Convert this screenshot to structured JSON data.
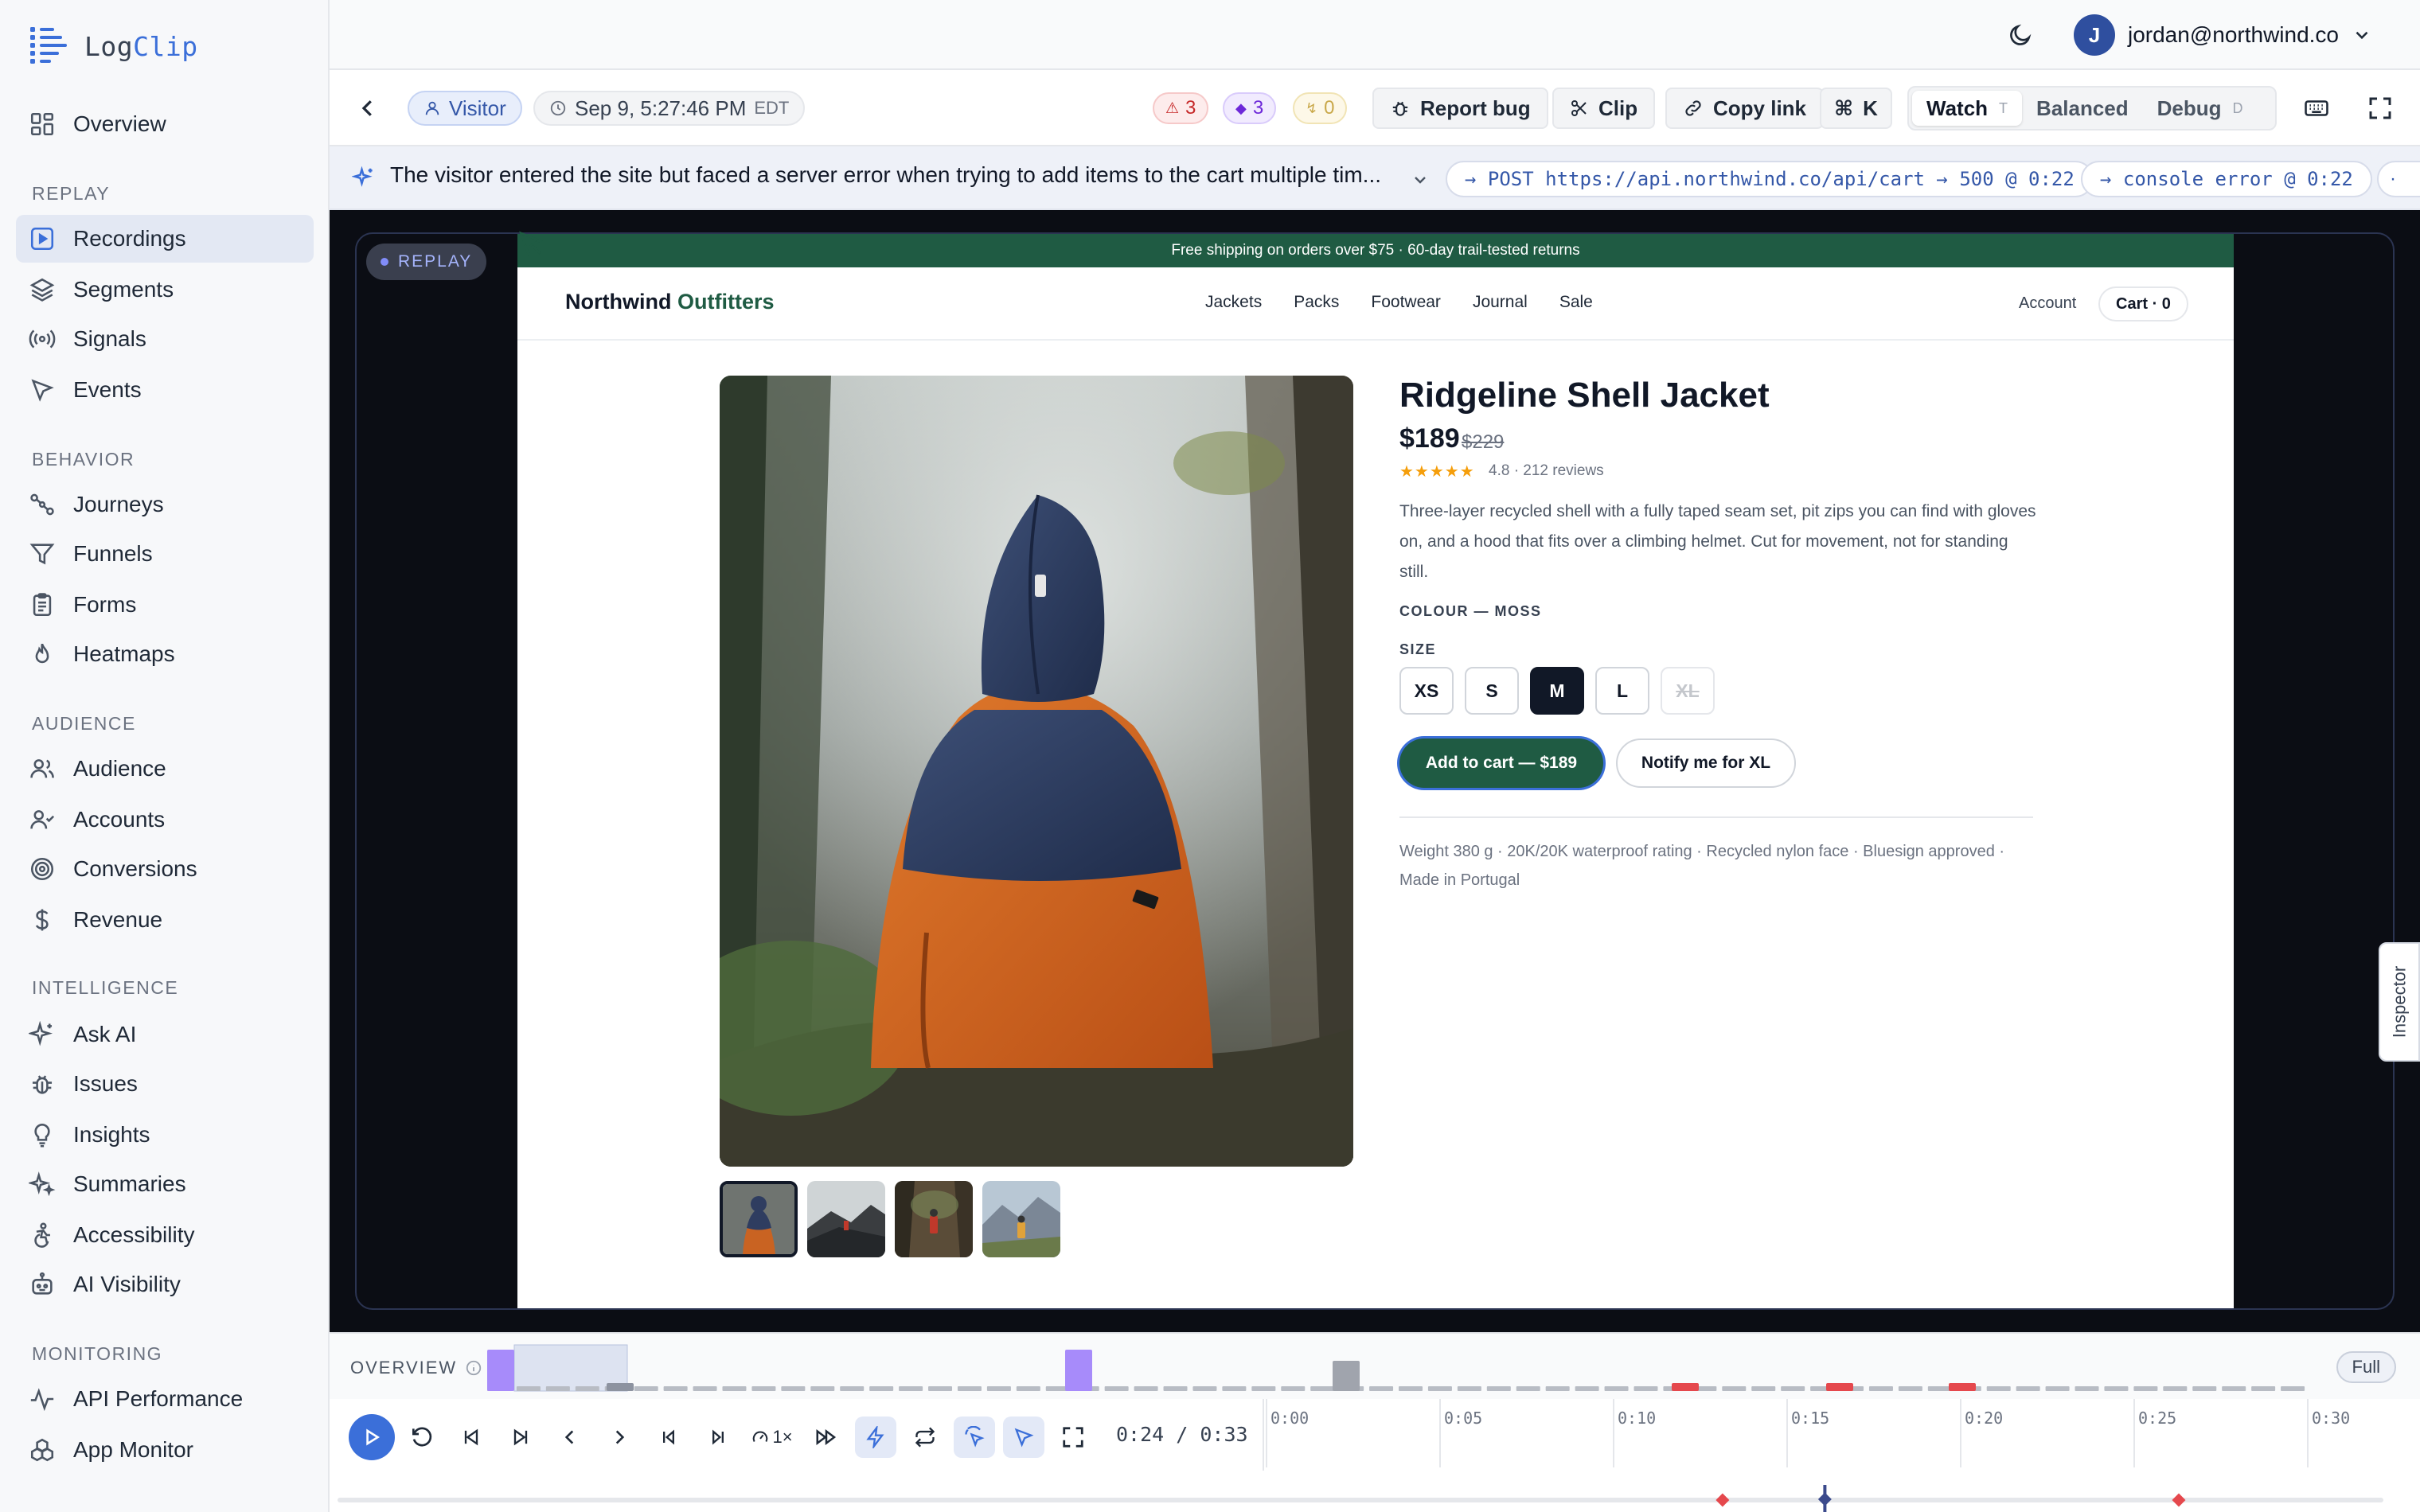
{
  "app": {
    "name_a": "Log",
    "name_b": "Clip"
  },
  "sidebar": {
    "overview": "Overview",
    "sections": {
      "replay": "REPLAY",
      "behavior": "BEHAVIOR",
      "audience": "AUDIENCE",
      "intelligence": "INTELLIGENCE",
      "monitoring": "MONITORING"
    },
    "items": {
      "recordings": "Recordings",
      "segments": "Segments",
      "signals": "Signals",
      "events": "Events",
      "journeys": "Journeys",
      "funnels": "Funnels",
      "forms": "Forms",
      "heatmaps": "Heatmaps",
      "audience": "Audience",
      "accounts": "Accounts",
      "conversions": "Conversions",
      "revenue": "Revenue",
      "ask_ai": "Ask AI",
      "issues": "Issues",
      "insights": "Insights",
      "summaries": "Summaries",
      "accessibility": "Accessibility",
      "ai_visibility": "AI Visibility",
      "api_performance": "API Performance",
      "app_monitor": "App Monitor"
    }
  },
  "topbar": {
    "avatar_initial": "J",
    "user_email": "jordan@northwind.co"
  },
  "session": {
    "visitor": "Visitor",
    "timestamp": "Sep 9, 5:27:46 PM",
    "timezone": "EDT",
    "counts": {
      "errors": "3",
      "events": "3",
      "frustration": "0"
    },
    "report_bug": "Report bug",
    "clip": "Clip",
    "copy_link": "Copy link",
    "cmd_k": "K",
    "modes": {
      "watch": "Watch",
      "watch_key": "T",
      "balanced": "Balanced",
      "debug": "Debug",
      "debug_key": "D"
    }
  },
  "summary": {
    "text": "The visitor entered the site but faced a server error when trying to add items to the cart multiple tim...",
    "chip_1": "→ POST https://api.northwind.co/api/cart → 500 @ 0:22",
    "chip_2": "→ console error @ 0:22"
  },
  "replay": {
    "badge": "REPLAY",
    "inspector": "Inspector",
    "site": {
      "promo": "Free shipping on orders over $75 · 60-day trail-tested returns",
      "logo_a": "Northwind ",
      "logo_b": "Outfitters",
      "nav": [
        "Jackets",
        "Packs",
        "Footwear",
        "Journal",
        "Sale"
      ],
      "account": "Account",
      "cart": "Cart · 0",
      "product": {
        "title": "Ridgeline Shell Jacket",
        "price": "$189",
        "was_price": "$229",
        "stars": "★★★★★",
        "rating": "4.8 · 212 reviews",
        "description": "Three-layer recycled shell with a fully taped seam set, pit zips you can find with gloves on, and a hood that fits over a climbing helmet. Cut for movement, not for standing still.",
        "colour": "COLOUR — MOSS",
        "size_label": "SIZE",
        "sizes": [
          "XS",
          "S",
          "M",
          "L",
          "XL"
        ],
        "selected_size": "M",
        "add_to_cart": "Add to cart — $189",
        "notify": "Notify me for XL",
        "specs": "Weight 380 g · 20K/20K waterproof rating · Recycled nylon face · Bluesign approved · Made in Portugal"
      }
    }
  },
  "player": {
    "overview_label": "OVERVIEW",
    "full_label": "Full",
    "speed": "1×",
    "current_time": "0:24",
    "duration": "0:33",
    "time_readout": "0:24 / 0:33",
    "ticks": [
      "0:00",
      "0:05",
      "0:10",
      "0:15",
      "0:20",
      "0:25",
      "0:30"
    ],
    "progress_fraction": 0.727
  },
  "colors": {
    "accent": "#3b6fd9",
    "brand_green": "#1f5b43",
    "error_red": "#e5484d",
    "event_purple": "#a78bfa",
    "sidebar_bg": "#f7f8fa"
  }
}
